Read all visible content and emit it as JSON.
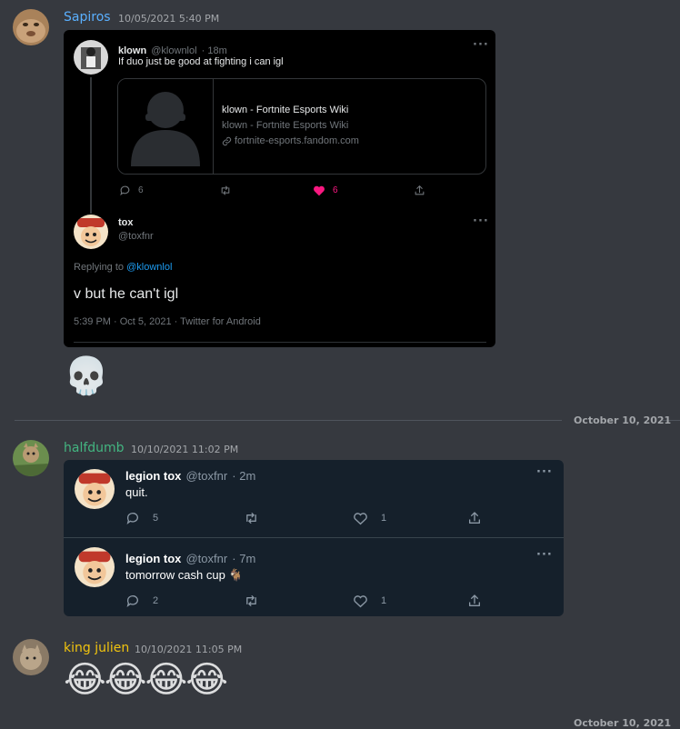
{
  "messages": [
    {
      "author": "Sapiros",
      "author_color": "#5ab0ff",
      "timestamp": "10/05/2021 5:40 PM",
      "reaction_emoji": "💀",
      "embed": {
        "tweet1": {
          "name": "klown",
          "handle": "@klownlol",
          "time": "· 18m",
          "text": "If duo just be good at fighting i can igl",
          "link_card": {
            "title": "klown - Fortnite Esports Wiki",
            "subtitle": "klown - Fortnite Esports Wiki",
            "domain": "fortnite-esports.fandom.com"
          },
          "replies": "6",
          "likes": "6"
        },
        "tweet2": {
          "name": "tox",
          "handle": "@toxfnr",
          "replying_to_label": "Replying to",
          "replying_to_handle": "@klownlol",
          "text": "v but he can't igl",
          "meta": "5:39 PM · Oct 5, 2021 · Twitter for Android"
        }
      }
    },
    {
      "author": "halfdumb",
      "author_color": "#43b581",
      "timestamp": "10/10/2021 11:02 PM",
      "tweets": [
        {
          "name": "legion tox",
          "handle": "@toxfnr",
          "time": "· 2m",
          "text": "quit.",
          "replies": "5",
          "likes": "1"
        },
        {
          "name": "legion tox",
          "handle": "@toxfnr",
          "time": "· 7m",
          "text": "tomorrow cash cup 🐐",
          "replies": "2",
          "likes": "1"
        }
      ]
    },
    {
      "author": "king julien",
      "author_color": "#f1c40f",
      "timestamp": "10/10/2021 11:05 PM",
      "emojis": "😂😂😂😂"
    }
  ],
  "date_divider": "October 10, 2021",
  "date_divider_partial": "October 10, 2021"
}
